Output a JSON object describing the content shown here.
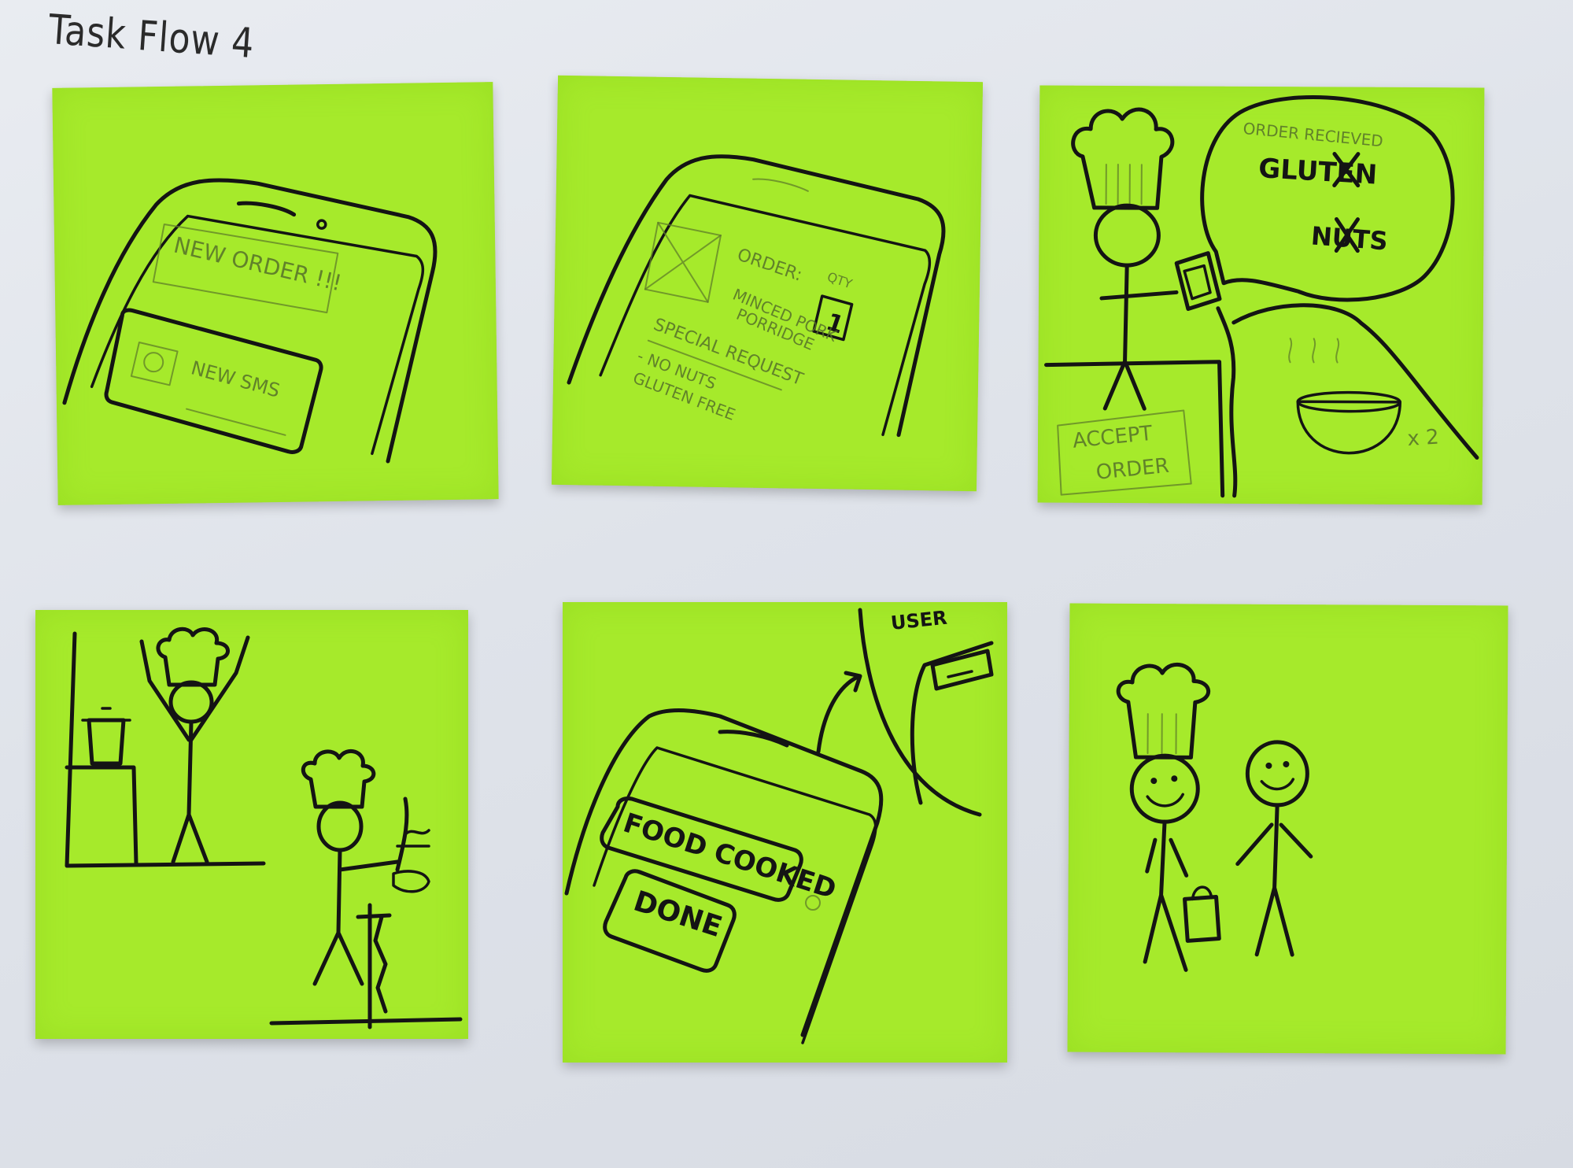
{
  "board": {
    "title": "Task Flow 4"
  },
  "colors": {
    "background": "#e2e6ec",
    "sticky_note": "#a6ea2b",
    "ink": "#141414",
    "pencil": "#5f7d2a"
  },
  "panels": {
    "p1": {
      "notification_banner": "NEW ORDER !!!",
      "sms_label": "NEW SMS"
    },
    "p2": {
      "order_label": "ORDER:",
      "qty_label": "QTY",
      "qty_value": "1",
      "item_line1": "MINCED PORK",
      "item_line2": "PORRIDGE",
      "special_request_label": "SPECIAL REQUEST",
      "request_line1": "- NO NUTS",
      "request_line2": "GLUTEN FREE"
    },
    "p3": {
      "bubble_title": "ORDER RECIEVED",
      "bubble_item1": "GLUTEN",
      "bubble_item2": "NUTS",
      "quantity": "x 2",
      "accept_line1": "ACCEPT",
      "accept_line2": "ORDER"
    },
    "p5": {
      "user_label": "USER",
      "food_cooked_button": "FOOD COOKED",
      "done_button": "DONE"
    }
  }
}
